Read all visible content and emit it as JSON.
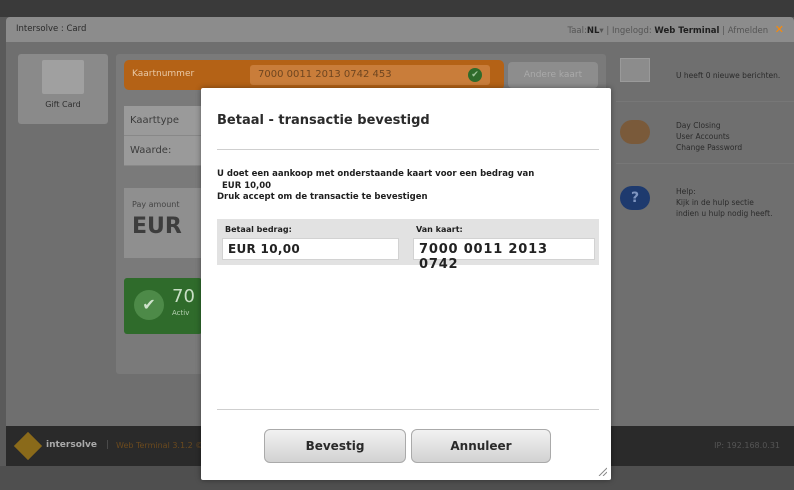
{
  "header": {
    "breadcrumb": "Intersolve : Card",
    "lang_label": "Taal:",
    "lang_value": "NL",
    "logged_label": "Ingelogd:",
    "logged_value": "Web Terminal",
    "logout": "Afmelden",
    "close_symbol": "✕"
  },
  "left": {
    "card_label": "Gift Card"
  },
  "card_bar": {
    "label": "Kaartnummer",
    "number": "7000 0011 2013 0742 453",
    "other_card": "Andere kaart"
  },
  "info": {
    "type_label": "Kaarttype",
    "value_label": "Waarde:"
  },
  "pay": {
    "label": "Pay amount",
    "currency": "EUR"
  },
  "status": {
    "number_partial": "70",
    "sub_partial": "Activ"
  },
  "sidebar": {
    "messages": "U heeft 0 nieuwe berichten.",
    "links": [
      "Day Closing",
      "User Accounts",
      "Change Password"
    ],
    "help_title": "Help:",
    "help_text_1": "Kijk in de hulp sectie",
    "help_text_2": "indien u hulp nodig heeft."
  },
  "footer": {
    "brand": "intersolve",
    "version": "Web Terminal 3.1.2 ©",
    "ip": "IP: 192.168.0.31"
  },
  "modal": {
    "title": "Betaal - transactie bevestigd",
    "line1": "U doet een aankoop met onderstaande kaart voor een bedrag van",
    "line2": "EUR 10,00",
    "line3": "Druk accept om de transactie te bevestigen",
    "amount_label": "Betaal bedrag:",
    "amount_value": "EUR 10,00",
    "card_label": "Van kaart:",
    "card_value": "7000 0011 2013 0742",
    "confirm": "Bevestig",
    "cancel": "Annuleer"
  }
}
